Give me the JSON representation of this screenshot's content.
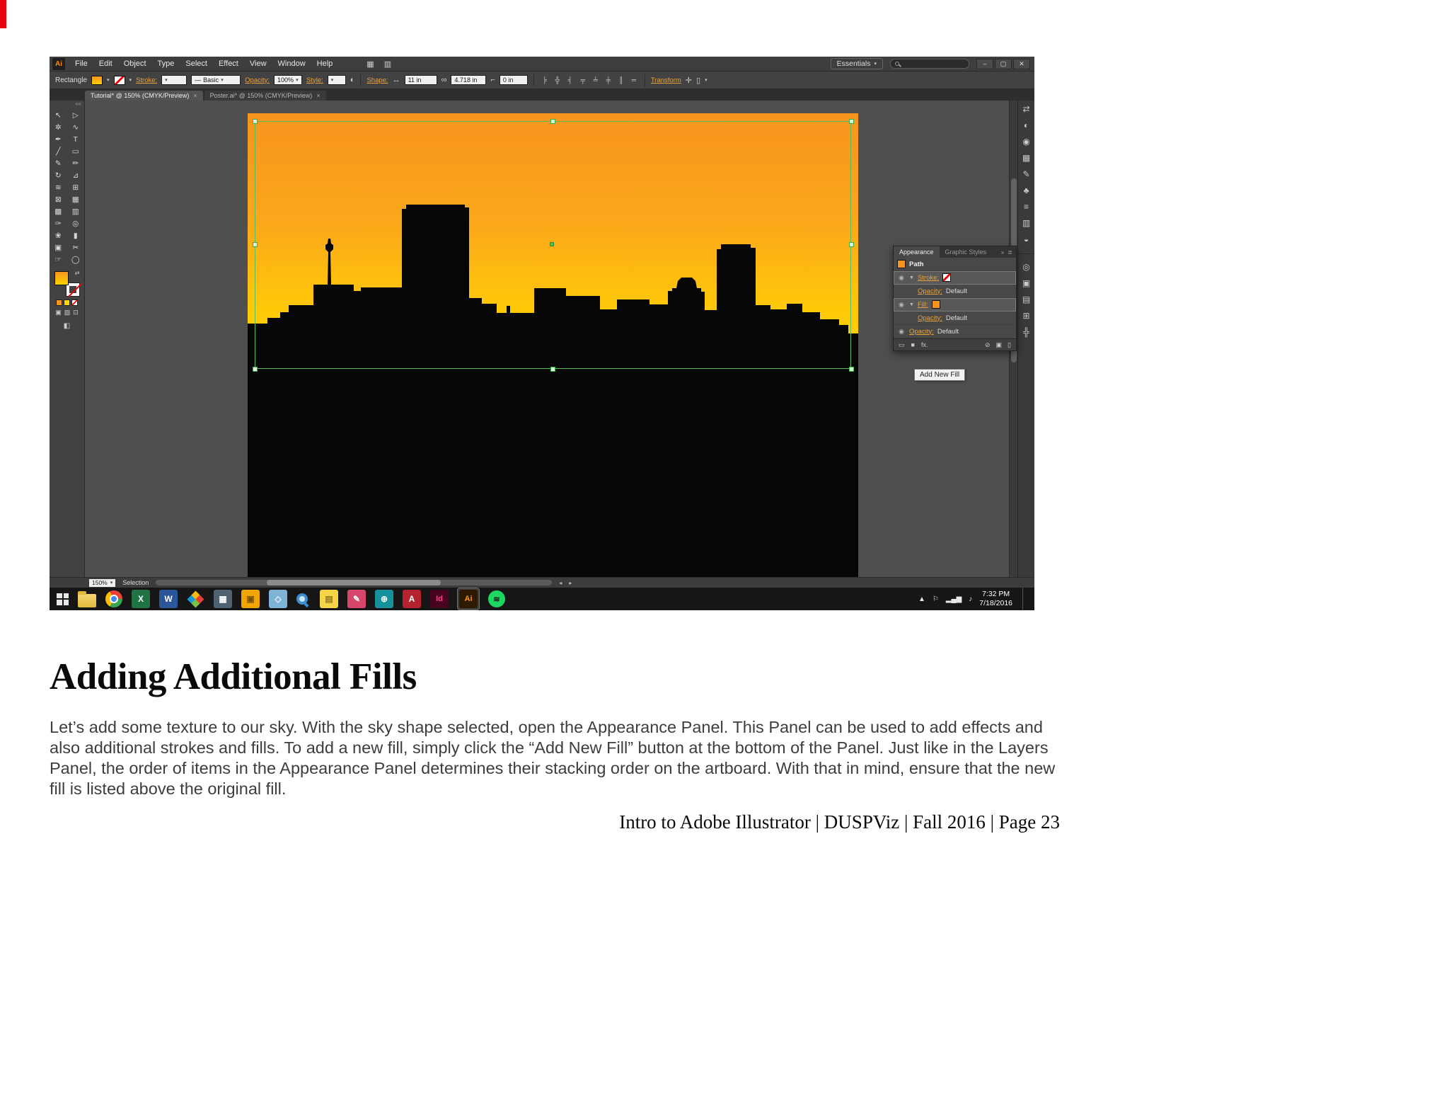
{
  "doc": {
    "heading": "Adding Additional Fills",
    "body": "Let’s add some texture to our sky. With the sky shape selected, open the Appearance Panel. This Panel can be used to add effects and also additional strokes and fills. To add a new fill, simply click the “Add New Fill” button at the bottom of the Panel. Just like in the Layers Panel, the order of items in the Appearance Panel determines their stacking order on the artboard. With that in mind, ensure that the new fill is listed above the original fill.",
    "footer": "Intro to Adobe Illustrator | DUSPViz | Fall 2016 | Page 23"
  },
  "app": {
    "logo": "Ai",
    "menus": [
      "File",
      "Edit",
      "Object",
      "Type",
      "Select",
      "Effect",
      "View",
      "Window",
      "Help"
    ],
    "extra_icons": [
      "▦",
      "▥"
    ],
    "workspace": "Essentials",
    "window": {
      "min": "–",
      "restore": "▢",
      "close": "✕"
    },
    "control": {
      "tool": "Rectangle",
      "stroke": "Stroke:",
      "brush": "Basic",
      "opacity": "Opacity:",
      "opacity_value": "100%",
      "style": "Style:",
      "shape": "Shape:",
      "width": "11 in",
      "height": "4.718 in",
      "corner": "0 in",
      "transform": "Transform"
    },
    "align_icons": [
      "╞",
      "╬",
      "╡",
      "╤",
      "╧",
      "╪",
      "║",
      "═"
    ],
    "tabs": {
      "tab1": "Tutorial* @ 150% (CMYK/Preview)",
      "tab2": "Poster.ai* @ 150% (CMYK/Preview)",
      "close": "×"
    },
    "tools": [
      {
        "name": "selection-tool",
        "glyph": "↖"
      },
      {
        "name": "direct-selection-tool",
        "glyph": "▷"
      },
      {
        "name": "magic-wand-tool",
        "glyph": "✲"
      },
      {
        "name": "lasso-tool",
        "glyph": "∿"
      },
      {
        "name": "pen-tool",
        "glyph": "✒"
      },
      {
        "name": "type-tool",
        "glyph": "T"
      },
      {
        "name": "line-tool",
        "glyph": "╱"
      },
      {
        "name": "rectangle-tool",
        "glyph": "▭"
      },
      {
        "name": "paintbrush-tool",
        "glyph": "✎"
      },
      {
        "name": "pencil-tool",
        "glyph": "✏"
      },
      {
        "name": "rotate-tool",
        "glyph": "↻"
      },
      {
        "name": "scale-tool",
        "glyph": "⊿"
      },
      {
        "name": "width-tool",
        "glyph": "≋"
      },
      {
        "name": "free-transform-tool",
        "glyph": "⊞"
      },
      {
        "name": "shape-builder-tool",
        "glyph": "⊠"
      },
      {
        "name": "perspective-grid-tool",
        "glyph": "▦"
      },
      {
        "name": "mesh-tool",
        "glyph": "▩"
      },
      {
        "name": "gradient-tool",
        "glyph": "▥"
      },
      {
        "name": "eyedropper-tool",
        "glyph": "✑"
      },
      {
        "name": "blend-tool",
        "glyph": "◎"
      },
      {
        "name": "symbol-sprayer-tool",
        "glyph": "❀"
      },
      {
        "name": "column-graph-tool",
        "glyph": "▮"
      },
      {
        "name": "artboard-tool",
        "glyph": "▣"
      },
      {
        "name": "slice-tool",
        "glyph": "✂"
      },
      {
        "name": "hand-tool",
        "glyph": "☞"
      },
      {
        "name": "zoom-tool",
        "glyph": "◯"
      }
    ],
    "dock": [
      {
        "name": "collapse-dock-icon",
        "glyph": "⇄"
      },
      {
        "name": "color-panel-icon",
        "glyph": "◐"
      },
      {
        "name": "color-guide-panel-icon",
        "glyph": "◉"
      },
      {
        "name": "swatches-panel-icon",
        "glyph": "▦"
      },
      {
        "name": "brushes-panel-icon",
        "glyph": "✎"
      },
      {
        "name": "symbols-panel-icon",
        "glyph": "♣"
      },
      {
        "name": "stroke-panel-icon",
        "glyph": "≡"
      },
      {
        "name": "gradient-panel-icon",
        "glyph": "▥"
      },
      {
        "name": "transparency-panel-icon",
        "glyph": "◒"
      },
      {
        "name": "appearance-panel-icon",
        "glyph": "◎"
      },
      {
        "name": "graphic-styles-panel-icon",
        "glyph": "▣"
      },
      {
        "name": "layers-panel-icon",
        "glyph": "▤"
      },
      {
        "name": "artboards-panel-icon",
        "glyph": "⊞"
      },
      {
        "name": "align-panel-icon",
        "glyph": "╬"
      }
    ],
    "status": {
      "zoom": "150%",
      "label": "Selection"
    }
  },
  "panel": {
    "tab_active": "Appearance",
    "tab_inactive": "Graphic Styles",
    "path": "Path",
    "stroke": "Stroke:",
    "fill": "Fill:",
    "opacity": "Opacity:",
    "value": "Default",
    "tooltip": "Add New Fill",
    "footer_icons": [
      {
        "name": "add-new-stroke-icon",
        "glyph": "▭"
      },
      {
        "name": "add-new-fill-icon",
        "glyph": "■"
      },
      {
        "name": "add-new-effect-icon",
        "glyph": "fx."
      },
      {
        "name": "clear-appearance-icon",
        "glyph": "⊘"
      },
      {
        "name": "duplicate-item-icon",
        "glyph": "▣"
      },
      {
        "name": "delete-item-icon",
        "glyph": "▯"
      }
    ]
  },
  "taskbar": {
    "icons": [
      {
        "name": "file-explorer",
        "glyph": ""
      },
      {
        "name": "chrome",
        "glyph": ""
      },
      {
        "name": "excel",
        "glyph": "X"
      },
      {
        "name": "word",
        "glyph": "W"
      },
      {
        "name": "office",
        "glyph": ""
      },
      {
        "name": "calculator",
        "glyph": "▦"
      },
      {
        "name": "3d-builder",
        "glyph": "▣"
      },
      {
        "name": "paint-3d",
        "glyph": "◇"
      },
      {
        "name": "search",
        "glyph": ""
      },
      {
        "name": "sticky-notes",
        "glyph": "▤"
      },
      {
        "name": "snipping-tool",
        "glyph": "✎"
      },
      {
        "name": "browser",
        "glyph": "⊕"
      },
      {
        "name": "autocad",
        "glyph": "A"
      },
      {
        "name": "indesign",
        "glyph": "Id"
      },
      {
        "name": "illustrator",
        "glyph": "Ai"
      },
      {
        "name": "spotify",
        "glyph": "≋"
      }
    ],
    "tray": {
      "chevron": "▲",
      "flag": "⚐",
      "network": "▂▄▆",
      "volume": "♪"
    },
    "time": "7:32 PM",
    "date": "7/18/2016"
  },
  "icons": {
    "eye": "◉",
    "caret": "▾",
    "disclosure": "▼",
    "chain": "∞",
    "width_arrow": "↔",
    "height_arrow": "↕",
    "corner": "⌐",
    "recolor": "◐",
    "crosshair": "✛",
    "menu": "≣",
    "double_right": "»",
    "swap": "⇄",
    "collapse": "««",
    "extra1": "▯",
    "line": "—"
  },
  "colors": {
    "sky_top": "#F7941E",
    "sky_bottom": "#FFD400",
    "silhouette": "#060606",
    "selection_green": "#55C05A",
    "link_orange": "#E8A33D",
    "ai_brand_orange": "#FF9A00",
    "excel_green": "#217346",
    "word_blue": "#2B579A",
    "spotify_green": "#1ED760",
    "indesign_pink": "#FF4087",
    "autocad_red": "#B3222D"
  }
}
